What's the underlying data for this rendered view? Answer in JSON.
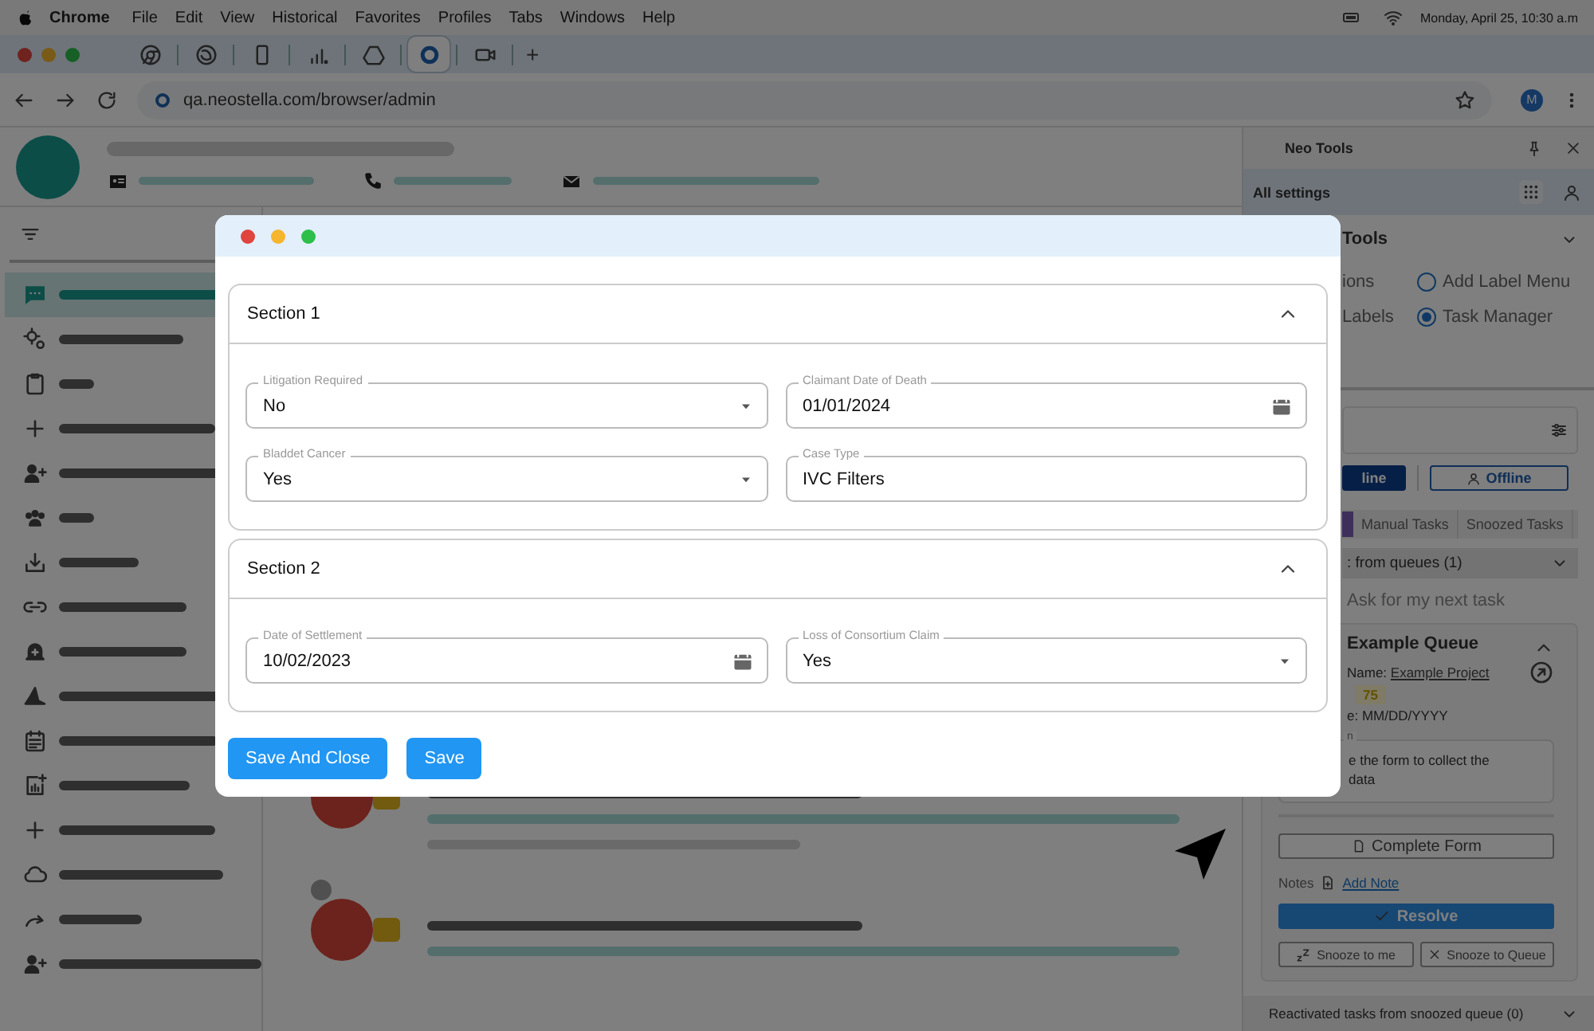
{
  "menubar": {
    "app": "Chrome",
    "menus": [
      "File",
      "Edit",
      "View",
      "Historical",
      "Favorites",
      "Profiles",
      "Tabs",
      "Windows",
      "Help"
    ],
    "clock": "Monday, April 25,  10:30 a.m"
  },
  "browser": {
    "tabs": [
      {
        "selected": false
      },
      {
        "selected": false
      },
      {
        "selected": false
      },
      {
        "selected": false
      },
      {
        "selected": false
      },
      {
        "selected": true
      },
      {
        "selected": false
      }
    ],
    "new_tab": "+",
    "url": "qa.neostella.com/browser/admin",
    "profile": "M"
  },
  "sidebar": {
    "items": [
      {
        "selected": true
      },
      {
        "selected": false
      },
      {
        "selected": false
      },
      {
        "selected": false
      },
      {
        "selected": false
      },
      {
        "selected": false
      },
      {
        "selected": false
      },
      {
        "selected": false
      },
      {
        "selected": false
      },
      {
        "selected": false
      },
      {
        "selected": false
      },
      {
        "selected": false
      },
      {
        "selected": false
      },
      {
        "selected": false
      },
      {
        "selected": false
      },
      {
        "selected": false
      }
    ]
  },
  "neo_tools": {
    "title": "Neo Tools",
    "settings_label": "All settings",
    "tools": {
      "title": "Tools",
      "partial_labels": [
        "ions",
        "Labels"
      ],
      "radios": [
        {
          "label": "Add Label Menu",
          "selected": false
        },
        {
          "label": "Task Manager",
          "selected": true
        }
      ]
    },
    "status": [
      {
        "label": "line",
        "selected": true
      },
      {
        "label": "Offline",
        "selected": false
      }
    ],
    "task_tabs": [
      {
        "label": "Manual Tasks",
        "selected": false
      },
      {
        "label": "Snoozed Tasks",
        "selected": false
      }
    ],
    "queue_group": {
      "title": ": from queues (1)",
      "ask_label": "Ask for my next task",
      "task": {
        "title": "Example Queue",
        "expanded": true,
        "project_label": "Name:",
        "project": "Example Project",
        "score": "75",
        "date": "e: MM/DD/YYYY",
        "description_label": "n",
        "description": "e the form to collect the data",
        "form_button": "Complete Form",
        "notes_label": "Notes",
        "add_note": "Add Note",
        "resolve": "Resolve",
        "snooze_me": "Snooze to me",
        "snooze_queue": "Snooze to Queue"
      }
    },
    "reactivated_group": {
      "title": "Reactivated tasks from snoozed queue (0)"
    }
  },
  "modal": {
    "sections": [
      {
        "title": "Section 1",
        "expanded": true,
        "fields": [
          {
            "label": "Litigation Required",
            "value": "No",
            "kind": "select"
          },
          {
            "label": "Claimant Date of Death",
            "value": "01/01/2024",
            "kind": "date"
          },
          {
            "label": "Bladdet Cancer",
            "value": "Yes",
            "kind": "select"
          },
          {
            "label": "Case Type",
            "value": "IVC Filters",
            "kind": "text"
          }
        ]
      },
      {
        "title": "Section 2",
        "expanded": true,
        "fields": [
          {
            "label": "Date of Settlement",
            "value": "10/02/2023",
            "kind": "date"
          },
          {
            "label": "Loss of Consortium Claim",
            "value": "Yes",
            "kind": "select"
          }
        ]
      }
    ],
    "buttons": [
      "Save And Close",
      "Save"
    ]
  }
}
